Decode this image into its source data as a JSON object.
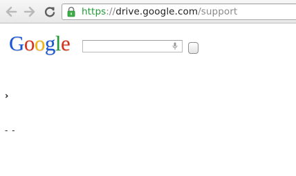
{
  "browser": {
    "url": {
      "scheme": "https",
      "separator": "://",
      "host": "drive.google.com",
      "path": "/support"
    },
    "icons": {
      "back": "arrow-left-icon",
      "forward": "arrow-right-icon",
      "reload": "reload-icon",
      "lock": "lock-icon"
    },
    "colors": {
      "scheme": "#1e9a34",
      "lock": "#3fae49"
    }
  },
  "header": {
    "logo_letters": [
      {
        "char": "G",
        "color": "#1a55d6"
      },
      {
        "char": "o",
        "color": "#d6321b"
      },
      {
        "char": "o",
        "color": "#f2b50f"
      },
      {
        "char": "g",
        "color": "#1a55d6"
      },
      {
        "char": "l",
        "color": "#1f9a38"
      },
      {
        "char": "e",
        "color": "#d6321b"
      }
    ],
    "search": {
      "value": "",
      "placeholder": "",
      "mic_icon": "microphone-icon"
    }
  },
  "content": {
    "chevron": "›",
    "dashes": "- -"
  }
}
